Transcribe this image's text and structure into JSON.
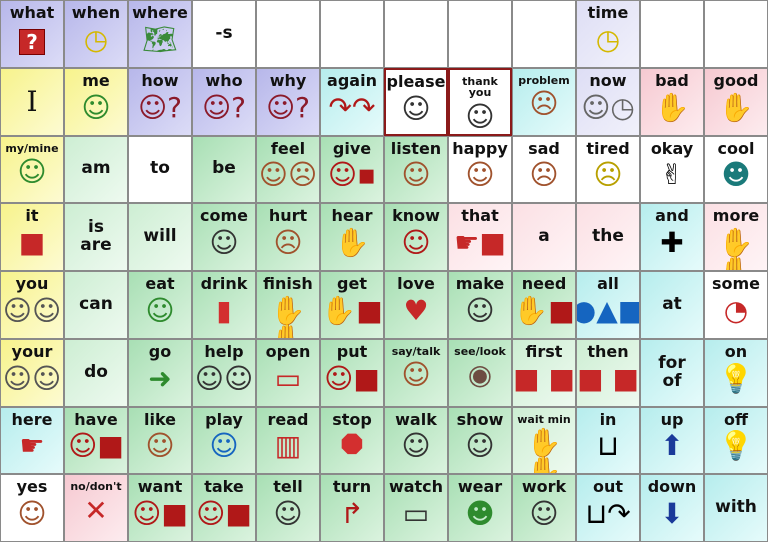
{
  "cells": [
    {
      "label": "what",
      "icon": "question-box-icon",
      "bg": "p"
    },
    {
      "label": "when",
      "icon": "clock-timeline-icon",
      "bg": "p"
    },
    {
      "label": "where",
      "icon": "map-icon",
      "bg": "p"
    },
    {
      "label": "-s",
      "icon": "",
      "bg": "w"
    },
    {
      "label": "",
      "icon": "",
      "bg": "w"
    },
    {
      "label": "",
      "icon": "",
      "bg": "w"
    },
    {
      "label": "",
      "icon": "",
      "bg": "w"
    },
    {
      "label": "",
      "icon": "",
      "bg": "w"
    },
    {
      "label": "",
      "icon": "",
      "bg": "w"
    },
    {
      "label": "time",
      "icon": "clock-icon",
      "bg": "lav"
    },
    {
      "label": "",
      "icon": "",
      "bg": "w"
    },
    {
      "label": "",
      "icon": "",
      "bg": "w"
    },
    {
      "label": "I",
      "icon": "",
      "bg": "y",
      "big": true
    },
    {
      "label": "me",
      "icon": "person-self-icon",
      "bg": "y"
    },
    {
      "label": "how",
      "icon": "person-question-icon",
      "bg": "p"
    },
    {
      "label": "who",
      "icon": "person-question-icon",
      "bg": "p"
    },
    {
      "label": "why",
      "icon": "person-question-icon",
      "bg": "p"
    },
    {
      "label": "again",
      "icon": "repeat-arrows-icon",
      "bg": "c"
    },
    {
      "label": "please",
      "icon": "person-please-icon",
      "bg": "w",
      "red": true
    },
    {
      "label": "thank you",
      "icon": "person-thanks-icon",
      "bg": "w",
      "red": true
    },
    {
      "label": "problem",
      "icon": "person-worried-icon",
      "bg": "c"
    },
    {
      "label": "now",
      "icon": "person-watch-icon",
      "bg": "lav"
    },
    {
      "label": "bad",
      "icon": "thumbs-down-icon",
      "bg": "pk"
    },
    {
      "label": "good",
      "icon": "thumbs-up-icon",
      "bg": "pk"
    },
    {
      "label": "my/mine",
      "icon": "person-self-icon",
      "bg": "y"
    },
    {
      "label": "am",
      "icon": "",
      "bg": "gl"
    },
    {
      "label": "to",
      "icon": "",
      "bg": "w"
    },
    {
      "label": "be",
      "icon": "",
      "bg": "g"
    },
    {
      "label": "feel",
      "icon": "faces-icon",
      "bg": "g"
    },
    {
      "label": "give",
      "icon": "person-give-icon",
      "bg": "g"
    },
    {
      "label": "listen",
      "icon": "ear-face-icon",
      "bg": "g"
    },
    {
      "label": "happy",
      "icon": "happy-face-icon",
      "bg": "w"
    },
    {
      "label": "sad",
      "icon": "sad-face-icon",
      "bg": "w"
    },
    {
      "label": "tired",
      "icon": "tired-face-icon",
      "bg": "w"
    },
    {
      "label": "okay",
      "icon": "ok-hand-icon",
      "bg": "w"
    },
    {
      "label": "cool",
      "icon": "cool-person-icon",
      "bg": "w"
    },
    {
      "label": "it",
      "icon": "red-square-icon",
      "bg": "y"
    },
    {
      "label": "is\nare",
      "icon": "",
      "bg": "gl"
    },
    {
      "label": "will",
      "icon": "",
      "bg": "gl"
    },
    {
      "label": "come",
      "icon": "person-come-icon",
      "bg": "g"
    },
    {
      "label": "hurt",
      "icon": "person-hurt-icon",
      "bg": "g"
    },
    {
      "label": "hear",
      "icon": "hand-ear-icon",
      "bg": "g"
    },
    {
      "label": "know",
      "icon": "person-know-icon",
      "bg": "g"
    },
    {
      "label": "that",
      "icon": "point-object-icon",
      "bg": "pkl"
    },
    {
      "label": "a",
      "icon": "",
      "bg": "pkl"
    },
    {
      "label": "the",
      "icon": "",
      "bg": "pkl"
    },
    {
      "label": "and",
      "icon": "plus-icon",
      "bg": "c"
    },
    {
      "label": "more",
      "icon": "hands-more-icon",
      "bg": "pkl"
    },
    {
      "label": "you",
      "icon": "people-point-icon",
      "bg": "y"
    },
    {
      "label": "can",
      "icon": "",
      "bg": "gl"
    },
    {
      "label": "eat",
      "icon": "person-eat-icon",
      "bg": "g"
    },
    {
      "label": "drink",
      "icon": "cup-icon",
      "bg": "g"
    },
    {
      "label": "finish",
      "icon": "hands-finish-icon",
      "bg": "g"
    },
    {
      "label": "get",
      "icon": "hand-get-icon",
      "bg": "g"
    },
    {
      "label": "love",
      "icon": "heart-icon",
      "bg": "g"
    },
    {
      "label": "make",
      "icon": "person-make-icon",
      "bg": "g"
    },
    {
      "label": "need",
      "icon": "hand-need-icon",
      "bg": "g"
    },
    {
      "label": "all",
      "icon": "shapes-icon",
      "bg": "c"
    },
    {
      "label": "at",
      "icon": "",
      "bg": "c"
    },
    {
      "label": "some",
      "icon": "pie-part-icon",
      "bg": "w"
    },
    {
      "label": "your",
      "icon": "people-point-icon",
      "bg": "y"
    },
    {
      "label": "do",
      "icon": "",
      "bg": "gl"
    },
    {
      "label": "go",
      "icon": "arrow-right-icon",
      "bg": "g"
    },
    {
      "label": "help",
      "icon": "people-help-icon",
      "bg": "g"
    },
    {
      "label": "open",
      "icon": "open-box-icon",
      "bg": "g"
    },
    {
      "label": "put",
      "icon": "person-put-icon",
      "bg": "g"
    },
    {
      "label": "say/talk",
      "icon": "talk-face-icon",
      "bg": "g"
    },
    {
      "label": "see/look",
      "icon": "eye-icon",
      "bg": "g"
    },
    {
      "label": "first",
      "icon": "first-blocks-icon",
      "bg": "gl"
    },
    {
      "label": "then",
      "icon": "then-blocks-icon",
      "bg": "gl"
    },
    {
      "label": "for\nof",
      "icon": "",
      "bg": "c"
    },
    {
      "label": "on",
      "icon": "bulb-on-icon",
      "bg": "c"
    },
    {
      "label": "here",
      "icon": "point-here-icon",
      "bg": "c"
    },
    {
      "label": "have",
      "icon": "person-have-icon",
      "bg": "g"
    },
    {
      "label": "like",
      "icon": "smile-face-icon",
      "bg": "g"
    },
    {
      "label": "play",
      "icon": "person-play-icon",
      "bg": "g"
    },
    {
      "label": "read",
      "icon": "book-icon",
      "bg": "g"
    },
    {
      "label": "stop",
      "icon": "stop-sign-icon",
      "bg": "g"
    },
    {
      "label": "walk",
      "icon": "person-walk-icon",
      "bg": "g"
    },
    {
      "label": "show",
      "icon": "person-show-icon",
      "bg": "g"
    },
    {
      "label": "wait min",
      "icon": "hands-wait-icon",
      "bg": "gl"
    },
    {
      "label": "in",
      "icon": "in-box-icon",
      "bg": "c"
    },
    {
      "label": "up",
      "icon": "arrow-up-icon",
      "bg": "c"
    },
    {
      "label": "off",
      "icon": "bulb-off-icon",
      "bg": "c"
    },
    {
      "label": "yes",
      "icon": "smile-face-icon",
      "bg": "w"
    },
    {
      "label": "no/don't",
      "icon": "red-x-icon",
      "bg": "pk"
    },
    {
      "label": "want",
      "icon": "person-want-icon",
      "bg": "g"
    },
    {
      "label": "take",
      "icon": "person-take-icon",
      "bg": "g"
    },
    {
      "label": "tell",
      "icon": "person-tell-icon",
      "bg": "g"
    },
    {
      "label": "turn",
      "icon": "turn-arrow-icon",
      "bg": "g"
    },
    {
      "label": "watch",
      "icon": "tv-icon",
      "bg": "g"
    },
    {
      "label": "wear",
      "icon": "cap-face-icon",
      "bg": "g"
    },
    {
      "label": "work",
      "icon": "person-work-icon",
      "bg": "g"
    },
    {
      "label": "out",
      "icon": "out-box-icon",
      "bg": "c"
    },
    {
      "label": "down",
      "icon": "arrow-down-icon",
      "bg": "c"
    },
    {
      "label": "with",
      "icon": "",
      "bg": "c"
    }
  ]
}
